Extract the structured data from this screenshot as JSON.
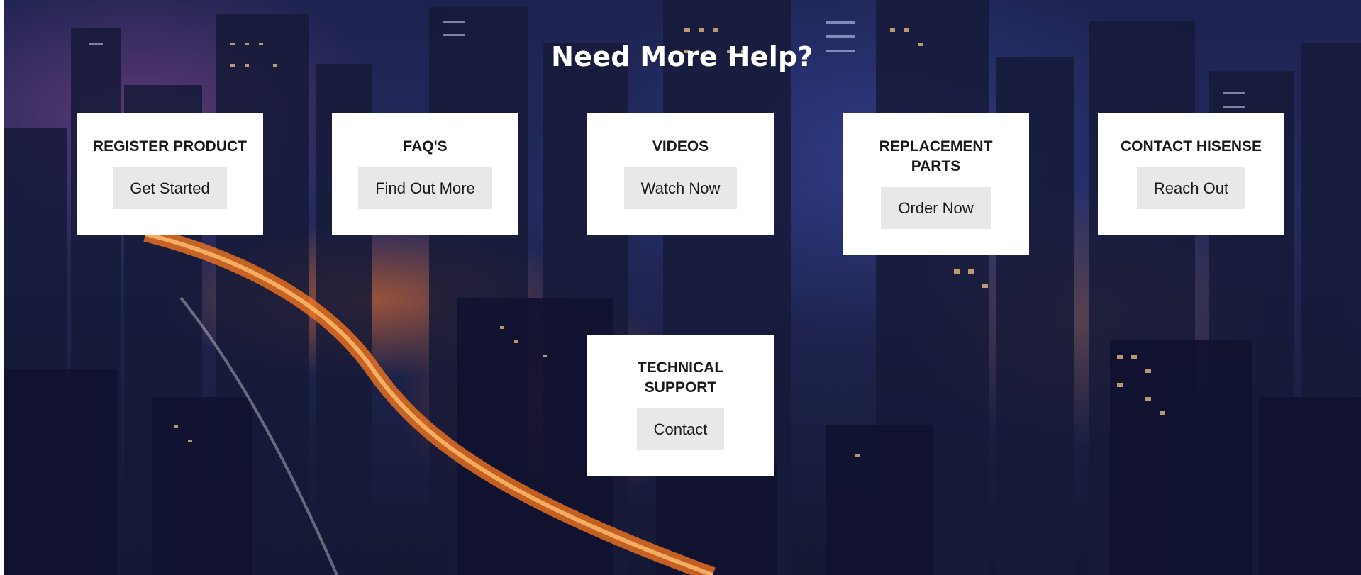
{
  "section": {
    "title": "Need More Help?"
  },
  "cards": [
    {
      "title": "REGISTER PRODUCT",
      "button": "Get Started"
    },
    {
      "title": "FAQ'S",
      "button": "Find Out More"
    },
    {
      "title": "VIDEOS",
      "button": "Watch Now"
    },
    {
      "title": "REPLACEMENT PARTS",
      "button": "Order Now"
    },
    {
      "title": "CONTACT HISENSE",
      "button": "Reach Out"
    },
    {
      "title": "TECHNICAL SUPPORT",
      "button": "Contact"
    }
  ],
  "colors": {
    "card_background": "#ffffff",
    "button_background": "#e8e8e8",
    "text_dark": "#1a1a1a",
    "title_text": "#ffffff"
  }
}
